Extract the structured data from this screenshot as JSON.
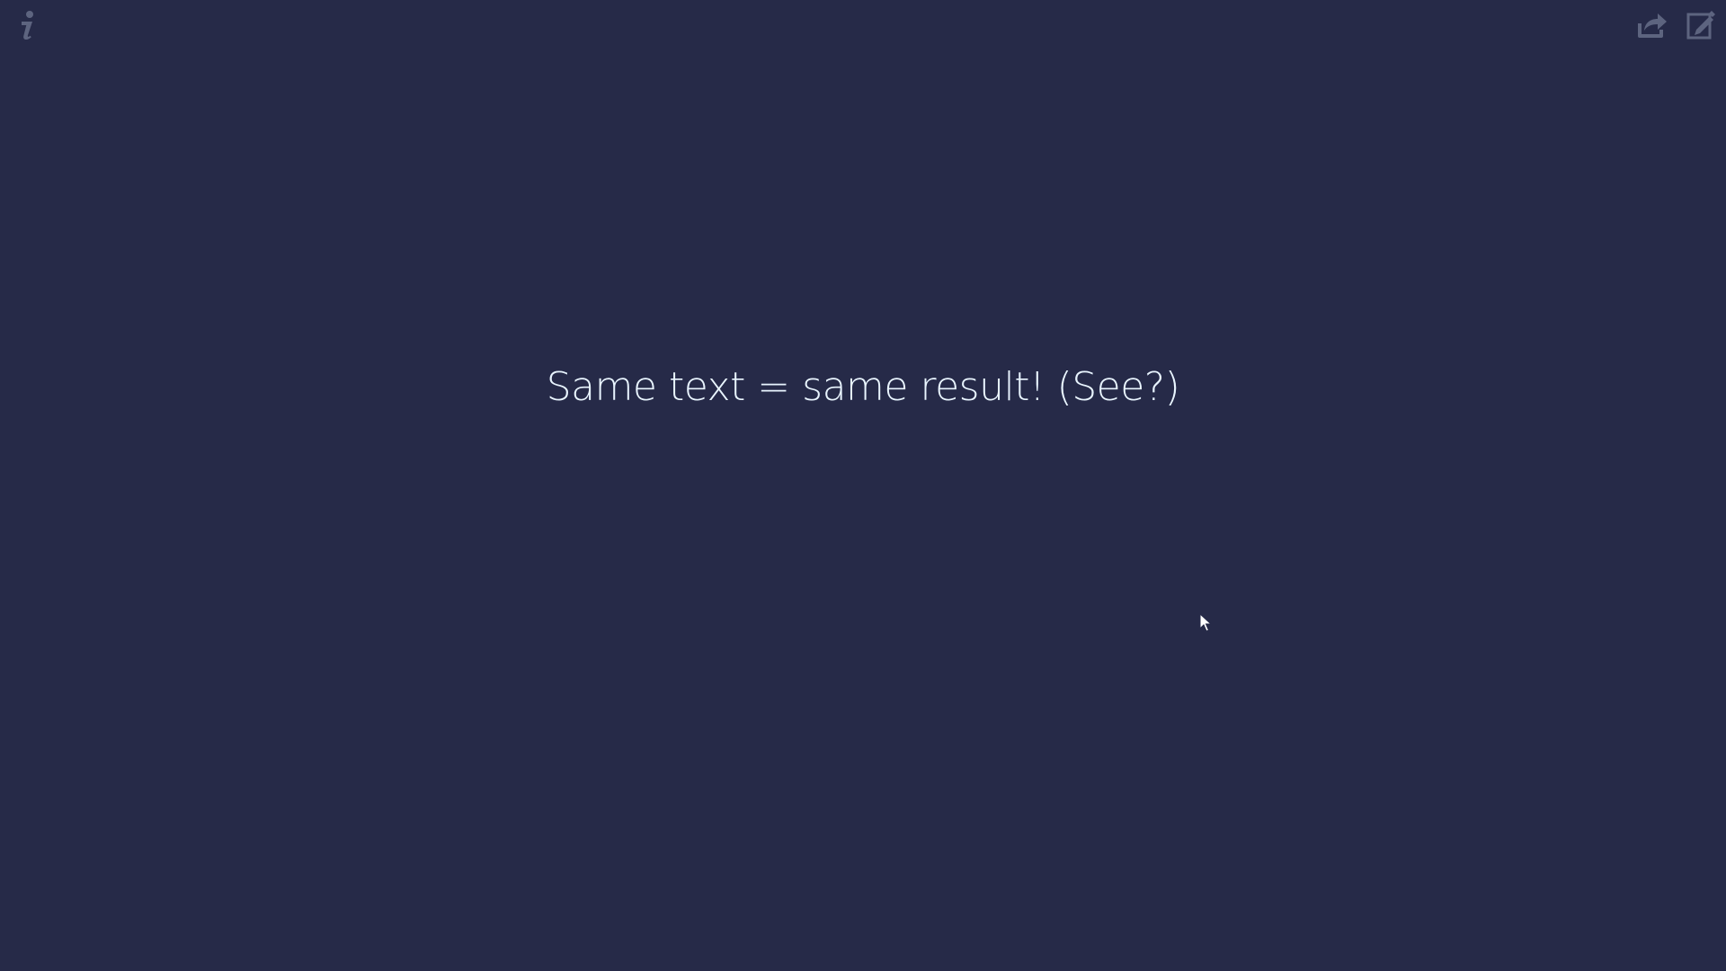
{
  "page": {
    "message": "Same text = same result! (See?)"
  },
  "toolbar": {
    "left_icons": [
      "info-icon"
    ],
    "right_icons": [
      "share-icon",
      "edit-icon"
    ]
  },
  "colors": {
    "background": "#262a48",
    "text": "#e9f5ff",
    "icon": "#646b86"
  }
}
